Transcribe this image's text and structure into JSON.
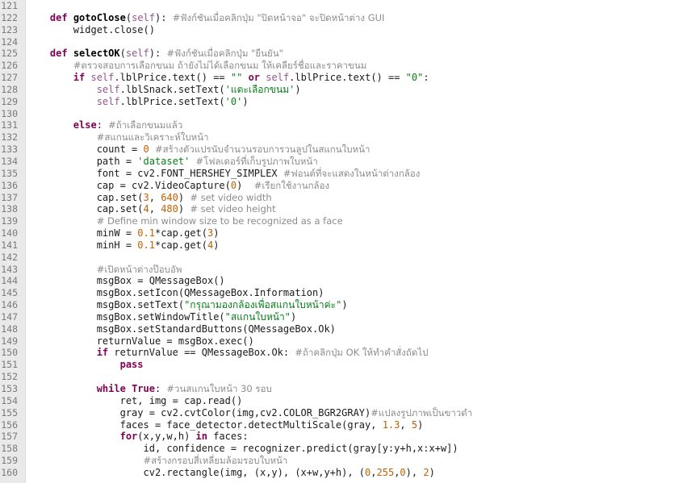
{
  "editor": {
    "lines": [
      {
        "n": "121",
        "tokens": []
      },
      {
        "n": "122",
        "tokens": [
          {
            "t": "    ",
            "c": ""
          },
          {
            "t": "def",
            "c": "kw"
          },
          {
            "t": " ",
            "c": ""
          },
          {
            "t": "gotoClose",
            "c": "fn"
          },
          {
            "t": "(",
            "c": ""
          },
          {
            "t": "self",
            "c": "sf"
          },
          {
            "t": "): ",
            "c": ""
          },
          {
            "t": "#ฟังก์ชันเมื่อคลิกปุ่ม \"ปิดหน้าจอ\" จะปิดหน้าต่าง GUI",
            "c": "cm"
          }
        ]
      },
      {
        "n": "123",
        "tokens": [
          {
            "t": "        widget.close()",
            "c": ""
          }
        ]
      },
      {
        "n": "124",
        "tokens": []
      },
      {
        "n": "125",
        "tokens": [
          {
            "t": "    ",
            "c": ""
          },
          {
            "t": "def",
            "c": "kw"
          },
          {
            "t": " ",
            "c": ""
          },
          {
            "t": "selectOK",
            "c": "fn"
          },
          {
            "t": "(",
            "c": ""
          },
          {
            "t": "self",
            "c": "sf"
          },
          {
            "t": "): ",
            "c": ""
          },
          {
            "t": "#ฟังก์ชันเมื่อคลิกปุ่ม \"ยืนยัน\"",
            "c": "cm"
          }
        ]
      },
      {
        "n": "126",
        "tokens": [
          {
            "t": "        ",
            "c": ""
          },
          {
            "t": "#ตรวจสอบการเลือกขนม ถ้ายังไม่ได้เลือกขนม ให้เคลียร์ชื่อและราคาขนม",
            "c": "cm"
          }
        ]
      },
      {
        "n": "127",
        "tokens": [
          {
            "t": "        ",
            "c": ""
          },
          {
            "t": "if",
            "c": "kw"
          },
          {
            "t": " ",
            "c": ""
          },
          {
            "t": "self",
            "c": "sf"
          },
          {
            "t": ".lblPrice.text() == ",
            "c": ""
          },
          {
            "t": "\"\"",
            "c": "str"
          },
          {
            "t": " ",
            "c": ""
          },
          {
            "t": "or",
            "c": "kw"
          },
          {
            "t": " ",
            "c": ""
          },
          {
            "t": "self",
            "c": "sf"
          },
          {
            "t": ".lblPrice.text() == ",
            "c": ""
          },
          {
            "t": "\"0\"",
            "c": "str"
          },
          {
            "t": ":",
            "c": ""
          }
        ]
      },
      {
        "n": "128",
        "tokens": [
          {
            "t": "            ",
            "c": ""
          },
          {
            "t": "self",
            "c": "sf"
          },
          {
            "t": ".lblSnack.setText(",
            "c": ""
          },
          {
            "t": "'แตะเลือกขนม'",
            "c": "str"
          },
          {
            "t": ")",
            "c": ""
          }
        ]
      },
      {
        "n": "129",
        "tokens": [
          {
            "t": "            ",
            "c": ""
          },
          {
            "t": "self",
            "c": "sf"
          },
          {
            "t": ".lblPrice.setText(",
            "c": ""
          },
          {
            "t": "'0'",
            "c": "str"
          },
          {
            "t": ")",
            "c": ""
          }
        ]
      },
      {
        "n": "130",
        "tokens": []
      },
      {
        "n": "131",
        "tokens": [
          {
            "t": "        ",
            "c": ""
          },
          {
            "t": "else",
            "c": "kw"
          },
          {
            "t": ": ",
            "c": ""
          },
          {
            "t": "#ถ้าเลือกขนมแล้ว",
            "c": "cm"
          }
        ]
      },
      {
        "n": "132",
        "tokens": [
          {
            "t": "            ",
            "c": ""
          },
          {
            "t": "#สแกนและวิเคราะห์ใบหน้า",
            "c": "cm"
          }
        ]
      },
      {
        "n": "133",
        "tokens": [
          {
            "t": "            count = ",
            "c": ""
          },
          {
            "t": "0",
            "c": "num"
          },
          {
            "t": " ",
            "c": ""
          },
          {
            "t": "#สร้างตัวแปรนับจำนวนรอบการวนลูปในสแกนใบหน้า",
            "c": "cm"
          }
        ]
      },
      {
        "n": "134",
        "tokens": [
          {
            "t": "            path = ",
            "c": ""
          },
          {
            "t": "'dataset'",
            "c": "str"
          },
          {
            "t": " ",
            "c": ""
          },
          {
            "t": "#โฟลเดอร์ที่เก็บรูปภาพใบหน้า",
            "c": "cm"
          }
        ]
      },
      {
        "n": "135",
        "tokens": [
          {
            "t": "            font = cv2.FONT_HERSHEY_SIMPLEX ",
            "c": ""
          },
          {
            "t": "#ฟอนต์ที่จะแสดงในหน้าต่างกล้อง",
            "c": "cm"
          }
        ]
      },
      {
        "n": "136",
        "tokens": [
          {
            "t": "            cap = cv2.VideoCapture(",
            "c": ""
          },
          {
            "t": "0",
            "c": "num"
          },
          {
            "t": ")  ",
            "c": ""
          },
          {
            "t": "#เรียกใช้งานกล้อง",
            "c": "cm"
          }
        ]
      },
      {
        "n": "137",
        "tokens": [
          {
            "t": "            cap.set(",
            "c": ""
          },
          {
            "t": "3",
            "c": "num"
          },
          {
            "t": ", ",
            "c": ""
          },
          {
            "t": "640",
            "c": "num"
          },
          {
            "t": ") ",
            "c": ""
          },
          {
            "t": "# set video width",
            "c": "cm"
          }
        ]
      },
      {
        "n": "138",
        "tokens": [
          {
            "t": "            cap.set(",
            "c": ""
          },
          {
            "t": "4",
            "c": "num"
          },
          {
            "t": ", ",
            "c": ""
          },
          {
            "t": "480",
            "c": "num"
          },
          {
            "t": ") ",
            "c": ""
          },
          {
            "t": "# set video height",
            "c": "cm"
          }
        ]
      },
      {
        "n": "139",
        "tokens": [
          {
            "t": "            ",
            "c": ""
          },
          {
            "t": "# Define min window size to be recognized as a face",
            "c": "cm"
          }
        ]
      },
      {
        "n": "140",
        "tokens": [
          {
            "t": "            minW = ",
            "c": ""
          },
          {
            "t": "0.1",
            "c": "num"
          },
          {
            "t": "*cap.get(",
            "c": ""
          },
          {
            "t": "3",
            "c": "num"
          },
          {
            "t": ")",
            "c": ""
          }
        ]
      },
      {
        "n": "141",
        "tokens": [
          {
            "t": "            minH = ",
            "c": ""
          },
          {
            "t": "0.1",
            "c": "num"
          },
          {
            "t": "*cap.get(",
            "c": ""
          },
          {
            "t": "4",
            "c": "num"
          },
          {
            "t": ")",
            "c": ""
          }
        ]
      },
      {
        "n": "142",
        "tokens": []
      },
      {
        "n": "143",
        "tokens": [
          {
            "t": "            ",
            "c": ""
          },
          {
            "t": "#เปิดหน้าต่างป๊อบอัพ",
            "c": "cm"
          }
        ]
      },
      {
        "n": "144",
        "tokens": [
          {
            "t": "            msgBox = QMessageBox()",
            "c": ""
          }
        ]
      },
      {
        "n": "145",
        "tokens": [
          {
            "t": "            msgBox.setIcon(QMessageBox.Information)",
            "c": ""
          }
        ]
      },
      {
        "n": "146",
        "tokens": [
          {
            "t": "            msgBox.setText(",
            "c": ""
          },
          {
            "t": "\"กรุณามองกล้องเพื่อสแกนใบหน้าค่ะ\"",
            "c": "str"
          },
          {
            "t": ")",
            "c": ""
          }
        ]
      },
      {
        "n": "147",
        "tokens": [
          {
            "t": "            msgBox.setWindowTitle(",
            "c": ""
          },
          {
            "t": "\"สแกนใบหน้า\"",
            "c": "str"
          },
          {
            "t": ")",
            "c": ""
          }
        ]
      },
      {
        "n": "148",
        "tokens": [
          {
            "t": "            msgBox.setStandardButtons(QMessageBox.Ok)",
            "c": ""
          }
        ]
      },
      {
        "n": "149",
        "tokens": [
          {
            "t": "            returnValue = msgBox.exec()",
            "c": ""
          }
        ]
      },
      {
        "n": "150",
        "tokens": [
          {
            "t": "            ",
            "c": ""
          },
          {
            "t": "if",
            "c": "kw"
          },
          {
            "t": " returnValue == QMessageBox.Ok: ",
            "c": ""
          },
          {
            "t": "#ถ้าคลิกปุ่ม OK ให้ทำคำสั่งถัดไป",
            "c": "cm"
          }
        ]
      },
      {
        "n": "151",
        "tokens": [
          {
            "t": "                ",
            "c": ""
          },
          {
            "t": "pass",
            "c": "kw"
          }
        ]
      },
      {
        "n": "152",
        "tokens": []
      },
      {
        "n": "153",
        "tokens": [
          {
            "t": "            ",
            "c": ""
          },
          {
            "t": "while",
            "c": "kw"
          },
          {
            "t": " ",
            "c": ""
          },
          {
            "t": "True",
            "c": "kw"
          },
          {
            "t": ": ",
            "c": ""
          },
          {
            "t": "#วนสแกนใบหน้า 30 รอบ",
            "c": "cm"
          }
        ]
      },
      {
        "n": "154",
        "tokens": [
          {
            "t": "                ret, img = cap.read()",
            "c": ""
          }
        ]
      },
      {
        "n": "155",
        "tokens": [
          {
            "t": "                gray = cv2.cvtColor(img,cv2.COLOR_BGR2GRAY)",
            "c": ""
          },
          {
            "t": "#แปลงรูปภาพเป็นขาวดำ",
            "c": "cm"
          }
        ]
      },
      {
        "n": "156",
        "tokens": [
          {
            "t": "                faces = face_detector.detectMultiScale(gray, ",
            "c": ""
          },
          {
            "t": "1.3",
            "c": "num"
          },
          {
            "t": ", ",
            "c": ""
          },
          {
            "t": "5",
            "c": "num"
          },
          {
            "t": ")",
            "c": ""
          }
        ]
      },
      {
        "n": "157",
        "tokens": [
          {
            "t": "                ",
            "c": ""
          },
          {
            "t": "for",
            "c": "kw"
          },
          {
            "t": "(x,y,w,h) ",
            "c": ""
          },
          {
            "t": "in",
            "c": "kw"
          },
          {
            "t": " faces:",
            "c": ""
          }
        ]
      },
      {
        "n": "158",
        "tokens": [
          {
            "t": "                    id, confidence = recognizer.predict(gray[y:y+h,x:x+w])",
            "c": ""
          }
        ]
      },
      {
        "n": "159",
        "tokens": [
          {
            "t": "                    ",
            "c": ""
          },
          {
            "t": "#สร้างกรอบสี่เหลี่ยมล้อมรอบใบหน้า",
            "c": "cm"
          }
        ]
      },
      {
        "n": "160",
        "tokens": [
          {
            "t": "                    cv2.rectangle(img, (x,y), (x+w,y+h), (",
            "c": ""
          },
          {
            "t": "0",
            "c": "num"
          },
          {
            "t": ",",
            "c": ""
          },
          {
            "t": "255",
            "c": "num"
          },
          {
            "t": ",",
            "c": ""
          },
          {
            "t": "0",
            "c": "num"
          },
          {
            "t": "), ",
            "c": ""
          },
          {
            "t": "2",
            "c": "num"
          },
          {
            "t": ")",
            "c": ""
          }
        ]
      }
    ]
  }
}
